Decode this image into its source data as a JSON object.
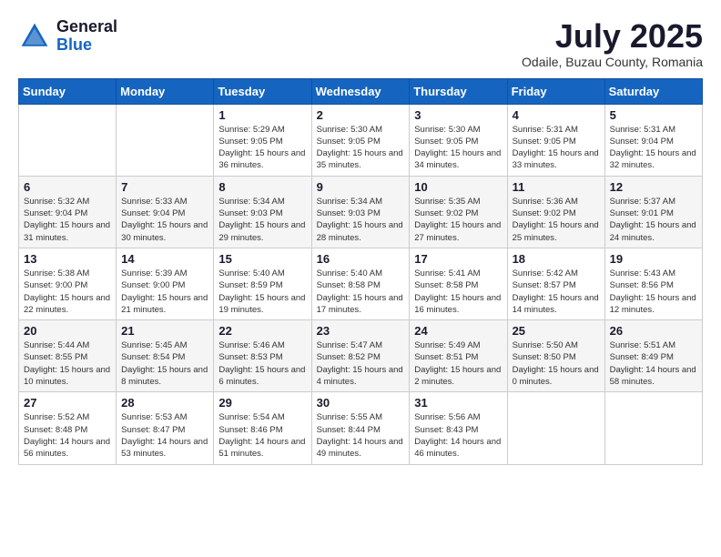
{
  "logo": {
    "general": "General",
    "blue": "Blue"
  },
  "title": "July 2025",
  "subtitle": "Odaile, Buzau County, Romania",
  "days_of_week": [
    "Sunday",
    "Monday",
    "Tuesday",
    "Wednesday",
    "Thursday",
    "Friday",
    "Saturday"
  ],
  "weeks": [
    [
      {
        "day": "",
        "info": ""
      },
      {
        "day": "",
        "info": ""
      },
      {
        "day": "1",
        "info": "Sunrise: 5:29 AM\nSunset: 9:05 PM\nDaylight: 15 hours and 36 minutes."
      },
      {
        "day": "2",
        "info": "Sunrise: 5:30 AM\nSunset: 9:05 PM\nDaylight: 15 hours and 35 minutes."
      },
      {
        "day": "3",
        "info": "Sunrise: 5:30 AM\nSunset: 9:05 PM\nDaylight: 15 hours and 34 minutes."
      },
      {
        "day": "4",
        "info": "Sunrise: 5:31 AM\nSunset: 9:05 PM\nDaylight: 15 hours and 33 minutes."
      },
      {
        "day": "5",
        "info": "Sunrise: 5:31 AM\nSunset: 9:04 PM\nDaylight: 15 hours and 32 minutes."
      }
    ],
    [
      {
        "day": "6",
        "info": "Sunrise: 5:32 AM\nSunset: 9:04 PM\nDaylight: 15 hours and 31 minutes."
      },
      {
        "day": "7",
        "info": "Sunrise: 5:33 AM\nSunset: 9:04 PM\nDaylight: 15 hours and 30 minutes."
      },
      {
        "day": "8",
        "info": "Sunrise: 5:34 AM\nSunset: 9:03 PM\nDaylight: 15 hours and 29 minutes."
      },
      {
        "day": "9",
        "info": "Sunrise: 5:34 AM\nSunset: 9:03 PM\nDaylight: 15 hours and 28 minutes."
      },
      {
        "day": "10",
        "info": "Sunrise: 5:35 AM\nSunset: 9:02 PM\nDaylight: 15 hours and 27 minutes."
      },
      {
        "day": "11",
        "info": "Sunrise: 5:36 AM\nSunset: 9:02 PM\nDaylight: 15 hours and 25 minutes."
      },
      {
        "day": "12",
        "info": "Sunrise: 5:37 AM\nSunset: 9:01 PM\nDaylight: 15 hours and 24 minutes."
      }
    ],
    [
      {
        "day": "13",
        "info": "Sunrise: 5:38 AM\nSunset: 9:00 PM\nDaylight: 15 hours and 22 minutes."
      },
      {
        "day": "14",
        "info": "Sunrise: 5:39 AM\nSunset: 9:00 PM\nDaylight: 15 hours and 21 minutes."
      },
      {
        "day": "15",
        "info": "Sunrise: 5:40 AM\nSunset: 8:59 PM\nDaylight: 15 hours and 19 minutes."
      },
      {
        "day": "16",
        "info": "Sunrise: 5:40 AM\nSunset: 8:58 PM\nDaylight: 15 hours and 17 minutes."
      },
      {
        "day": "17",
        "info": "Sunrise: 5:41 AM\nSunset: 8:58 PM\nDaylight: 15 hours and 16 minutes."
      },
      {
        "day": "18",
        "info": "Sunrise: 5:42 AM\nSunset: 8:57 PM\nDaylight: 15 hours and 14 minutes."
      },
      {
        "day": "19",
        "info": "Sunrise: 5:43 AM\nSunset: 8:56 PM\nDaylight: 15 hours and 12 minutes."
      }
    ],
    [
      {
        "day": "20",
        "info": "Sunrise: 5:44 AM\nSunset: 8:55 PM\nDaylight: 15 hours and 10 minutes."
      },
      {
        "day": "21",
        "info": "Sunrise: 5:45 AM\nSunset: 8:54 PM\nDaylight: 15 hours and 8 minutes."
      },
      {
        "day": "22",
        "info": "Sunrise: 5:46 AM\nSunset: 8:53 PM\nDaylight: 15 hours and 6 minutes."
      },
      {
        "day": "23",
        "info": "Sunrise: 5:47 AM\nSunset: 8:52 PM\nDaylight: 15 hours and 4 minutes."
      },
      {
        "day": "24",
        "info": "Sunrise: 5:49 AM\nSunset: 8:51 PM\nDaylight: 15 hours and 2 minutes."
      },
      {
        "day": "25",
        "info": "Sunrise: 5:50 AM\nSunset: 8:50 PM\nDaylight: 15 hours and 0 minutes."
      },
      {
        "day": "26",
        "info": "Sunrise: 5:51 AM\nSunset: 8:49 PM\nDaylight: 14 hours and 58 minutes."
      }
    ],
    [
      {
        "day": "27",
        "info": "Sunrise: 5:52 AM\nSunset: 8:48 PM\nDaylight: 14 hours and 56 minutes."
      },
      {
        "day": "28",
        "info": "Sunrise: 5:53 AM\nSunset: 8:47 PM\nDaylight: 14 hours and 53 minutes."
      },
      {
        "day": "29",
        "info": "Sunrise: 5:54 AM\nSunset: 8:46 PM\nDaylight: 14 hours and 51 minutes."
      },
      {
        "day": "30",
        "info": "Sunrise: 5:55 AM\nSunset: 8:44 PM\nDaylight: 14 hours and 49 minutes."
      },
      {
        "day": "31",
        "info": "Sunrise: 5:56 AM\nSunset: 8:43 PM\nDaylight: 14 hours and 46 minutes."
      },
      {
        "day": "",
        "info": ""
      },
      {
        "day": "",
        "info": ""
      }
    ]
  ]
}
